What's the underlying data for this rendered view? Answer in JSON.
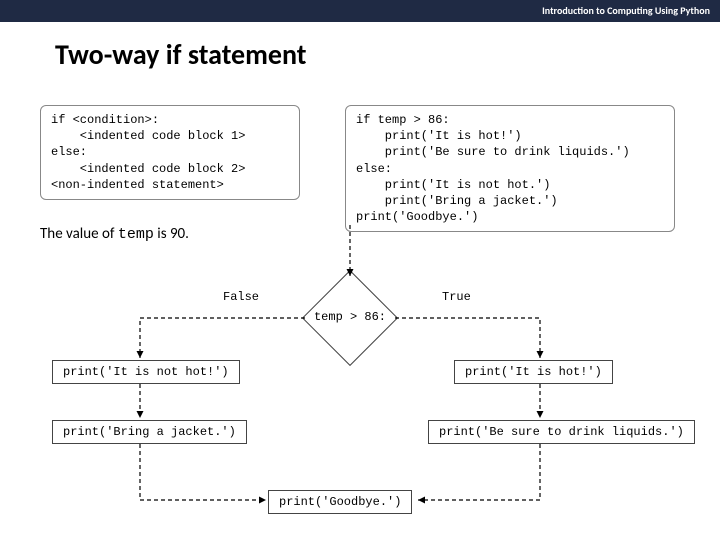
{
  "header": {
    "course": "Introduction to Computing Using Python"
  },
  "title": "Two-way if statement",
  "code_template": "if <condition>:\n    <indented code block 1>\nelse:\n    <indented code block 2>\n<non-indented statement>",
  "code_example": "if temp > 86:\n    print('It is hot!')\n    print('Be sure to drink liquids.')\nelse:\n    print('It is not hot.')\n    print('Bring a jacket.')\nprint('Goodbye.')",
  "value_sentence_pre": "The value of ",
  "value_var": "temp",
  "value_sentence_post": " is 90.",
  "branch_false": "False",
  "branch_true": "True",
  "condition": "temp > 86:",
  "nodes": {
    "left1": "print('It is not hot!')",
    "left2": "print('Bring a jacket.')",
    "right1": "print('It is hot!')",
    "right2": "print('Be sure to drink liquids.')",
    "final": "print('Goodbye.')"
  }
}
